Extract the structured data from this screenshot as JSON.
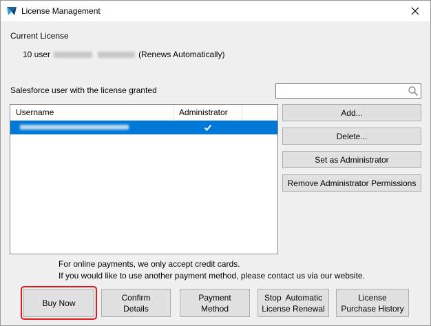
{
  "window": {
    "title": "License Management",
    "app_icon": "app-logo-icon",
    "close_icon": "close-icon"
  },
  "current_license": {
    "heading": "Current License",
    "seats": "10 user",
    "renewal_note": "(Renews Automatically)"
  },
  "users_section": {
    "heading": "Salesforce user with the license granted",
    "search": {
      "value": "",
      "placeholder": "",
      "icon": "search-icon"
    },
    "table": {
      "columns": [
        "Username",
        "Administrator",
        ""
      ],
      "rows": [
        {
          "username": "",
          "is_admin": true,
          "selected": true
        }
      ],
      "selection_color": "#0078d7"
    },
    "buttons": {
      "add": "Add...",
      "delete": "Delete...",
      "set_admin": "Set as Administrator",
      "remove_admin": "Remove Administrator Permissions"
    }
  },
  "payment_note": {
    "line1": "For online payments, we only accept credit cards.",
    "line2": "If you would like to use another payment method, please contact us via our website."
  },
  "bottom_buttons": {
    "buy_now": "Buy Now",
    "confirm_details": [
      "Confirm",
      "Details"
    ],
    "payment_method": [
      "Payment",
      "Method"
    ],
    "stop_renewal": [
      "Stop  Automatic",
      "License Renewal"
    ],
    "purchase_history": [
      "License",
      "Purchase History"
    ]
  },
  "colors": {
    "focus_highlight": "#e0191e",
    "button_face": "#e1e1e1",
    "window_bg": "#f0f0f0"
  }
}
